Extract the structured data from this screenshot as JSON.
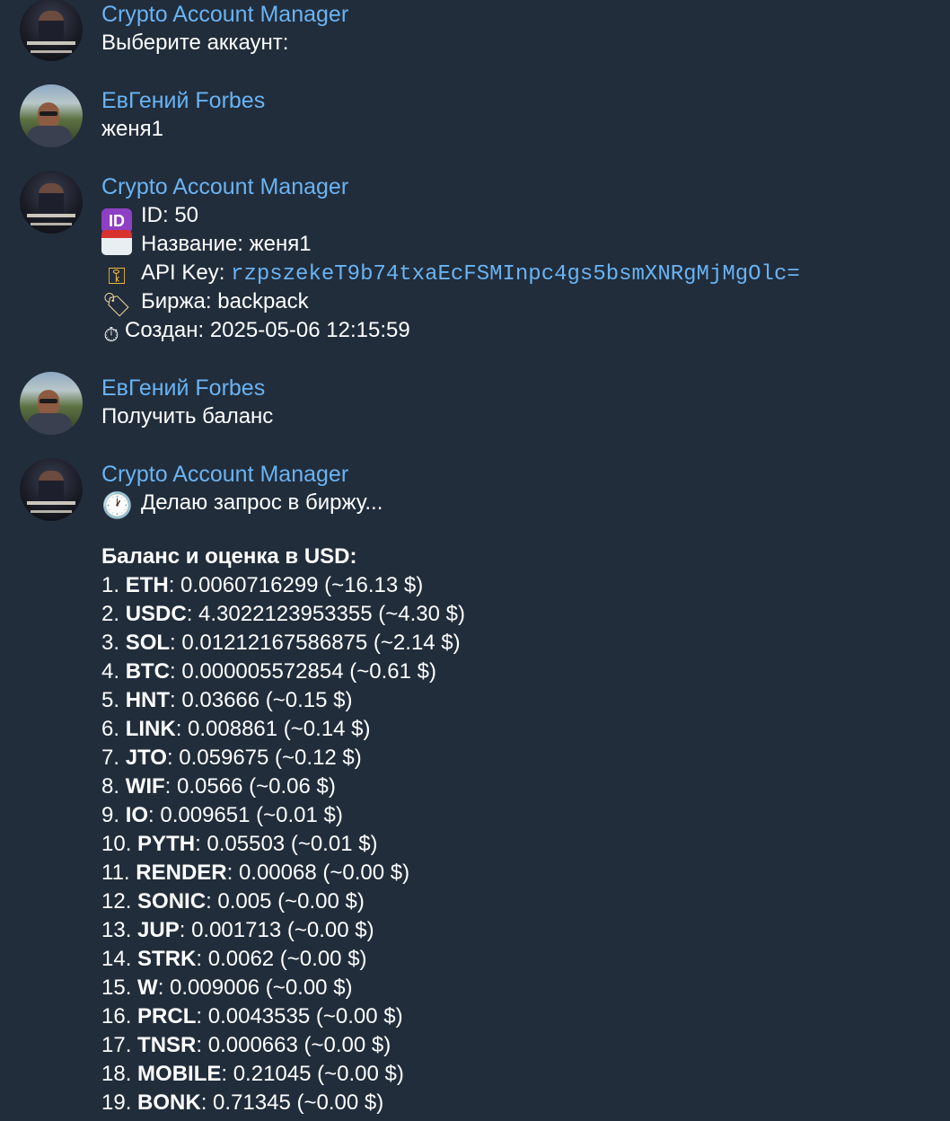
{
  "messages": [
    {
      "sender": "Crypto Account Manager",
      "avatar": "bot-avatar",
      "text": "Выберите аккаунт:"
    },
    {
      "sender": "ЕвГений Forbes",
      "avatar": "user-avatar",
      "text": "женя1"
    },
    {
      "sender": "Crypto Account Manager",
      "avatar": "bot-avatar",
      "account_card": {
        "id_icon": "id-emoji-icon",
        "id_text": "ID: 50",
        "name_icon": "name-badge-emoji-icon",
        "name_text": "Название: женя1",
        "key_icon": "key-emoji-icon",
        "key_label": "API Key: ",
        "key_value": "rzpszekeT9b74txaEcFSMInpc4gs5bsmXNRgMjMgOlc=",
        "exchange_icon": "label-tag-emoji-icon",
        "exchange_text": "Биржа: backpack",
        "created_icon": "stopwatch-emoji-icon",
        "created_text": "Создан: 2025-05-06 12:15:59"
      }
    },
    {
      "sender": "ЕвГений Forbes",
      "avatar": "user-avatar",
      "text": "Получить баланс"
    },
    {
      "sender": "Crypto Account Manager",
      "avatar": "bot-avatar",
      "pending_icon": "clock-emoji-icon",
      "pending_text": "Делаю запрос в биржу...",
      "balance_title": "Баланс и оценка в USD:",
      "balances": [
        {
          "num": "1.",
          "ticker": "ETH",
          "rest": ": 0.0060716299 (~16.13 $)"
        },
        {
          "num": "2.",
          "ticker": "USDC",
          "rest": ": 4.3022123953355 (~4.30 $)"
        },
        {
          "num": "3.",
          "ticker": "SOL",
          "rest": ": 0.01212167586875 (~2.14 $)"
        },
        {
          "num": "4.",
          "ticker": "BTC",
          "rest": ": 0.000005572854 (~0.61 $)"
        },
        {
          "num": "5.",
          "ticker": "HNT",
          "rest": ": 0.03666 (~0.15 $)"
        },
        {
          "num": "6.",
          "ticker": "LINK",
          "rest": ": 0.008861 (~0.14 $)"
        },
        {
          "num": "7.",
          "ticker": "JTO",
          "rest": ": 0.059675 (~0.12 $)"
        },
        {
          "num": "8.",
          "ticker": "WIF",
          "rest": ": 0.0566 (~0.06 $)"
        },
        {
          "num": "9.",
          "ticker": "IO",
          "rest": ": 0.009651 (~0.01 $)"
        },
        {
          "num": "10.",
          "ticker": "PYTH",
          "rest": ": 0.05503 (~0.01 $)"
        },
        {
          "num": "11.",
          "ticker": "RENDER",
          "rest": ": 0.00068 (~0.00 $)"
        },
        {
          "num": "12.",
          "ticker": "SONIC",
          "rest": ": 0.005 (~0.00 $)"
        },
        {
          "num": "13.",
          "ticker": "JUP",
          "rest": ": 0.001713 (~0.00 $)"
        },
        {
          "num": "14.",
          "ticker": "STRK",
          "rest": ": 0.0062 (~0.00 $)"
        },
        {
          "num": "15.",
          "ticker": "W",
          "rest": ": 0.009006 (~0.00 $)"
        },
        {
          "num": "16.",
          "ticker": "PRCL",
          "rest": ": 0.0043535 (~0.00 $)"
        },
        {
          "num": "17.",
          "ticker": "TNSR",
          "rest": ": 0.000663 (~0.00 $)"
        },
        {
          "num": "18.",
          "ticker": "MOBILE",
          "rest": ": 0.21045 (~0.00 $)"
        },
        {
          "num": "19.",
          "ticker": "BONK",
          "rest": ": 0.71345 (~0.00 $)"
        }
      ]
    }
  ],
  "colors": {
    "background": "#212d3b",
    "sender_name": "#6ab3f3",
    "text": "#ffffff",
    "code": "#6ab3f3"
  }
}
